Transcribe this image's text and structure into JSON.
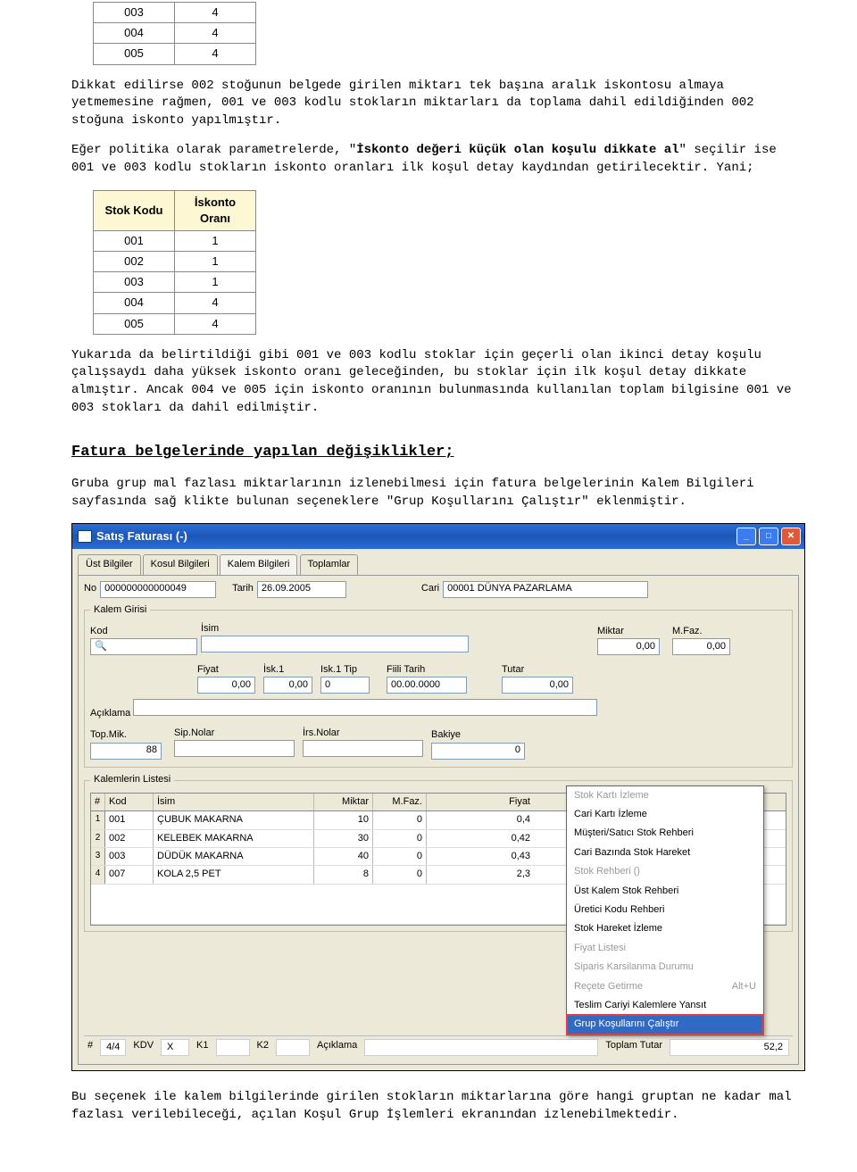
{
  "table1": {
    "rows": [
      [
        "003",
        "4"
      ],
      [
        "004",
        "4"
      ],
      [
        "005",
        "4"
      ]
    ]
  },
  "para1": "Dikkat edilirse 002 stoğunun belgede girilen miktarı tek başına aralık iskontosu almaya yetmemesine rağmen, 001 ve 003 kodlu stokların miktarları da toplama dahil edildiğinden 002 stoğuna iskonto yapılmıştır.",
  "para2a": "Eğer politika olarak parametrelerde, \"",
  "para2b": "İskonto değeri küçük olan koşulu dikkate al",
  "para2c": "\" seçilir ise 001 ve 003 kodlu stokların iskonto oranları ilk koşul detay kaydından getirilecektir. Yani;",
  "table2": {
    "headers": [
      "Stok Kodu",
      "İskonto Oranı"
    ],
    "rows": [
      [
        "001",
        "1"
      ],
      [
        "002",
        "1"
      ],
      [
        "003",
        "1"
      ],
      [
        "004",
        "4"
      ],
      [
        "005",
        "4"
      ]
    ]
  },
  "para3": "Yukarıda da belirtildiği gibi 001 ve 003 kodlu stoklar için geçerli olan ikinci detay koşulu çalışsaydı daha yüksek iskonto oranı geleceğinden, bu stoklar için ilk koşul detay dikkate almıştır. Ancak 004 ve 005 için iskonto oranının bulunmasında kullanılan toplam bilgisine 001 ve 003 stokları da dahil edilmiştir.",
  "h3": "Fatura belgelerinde yapılan değişiklikler;",
  "para4": "Gruba grup mal fazlası miktarlarının izlenebilmesi için fatura belgelerinin Kalem Bilgileri sayfasında sağ klikte bulunan seçeneklere \"Grup Koşullarını Çalıştır\" eklenmiştir.",
  "win": {
    "title": "Satış Faturası (-)",
    "tabs": [
      "Üst Bilgiler",
      "Kosul Bilgileri",
      "Kalem Bilgileri",
      "Toplamlar"
    ],
    "activeTab": 2,
    "top": {
      "no_l": "No",
      "no": "000000000000049",
      "tarih_l": "Tarih",
      "tarih": "26.09.2005",
      "cari_l": "Cari",
      "cari": "00001 DÜNYA PAZARLAMA"
    },
    "kg_legend": "Kalem Girisi",
    "kg": {
      "kod_l": "Kod",
      "isim_l": "İsim",
      "miktar_l": "Miktar",
      "miktar": "0,00",
      "mfaz_l": "M.Faz.",
      "mfaz": "0,00",
      "fiyat_l": "Fiyat",
      "fiyat": "0,00",
      "isk1_l": "İsk.1",
      "isk1": "0,00",
      "isk1tip_l": "Isk.1 Tip",
      "isk1tip": "0",
      "fiili_l": "Fiili Tarih",
      "fiili": "00.00.0000",
      "tutar_l": "Tutar",
      "tutar": "0,00",
      "aciklama_l": "Açıklama",
      "topmik_l": "Top.Mik.",
      "topmik": "88",
      "sipnolar_l": "Sip.Nolar",
      "irsnolar_l": "İrs.Nolar",
      "bakiye_l": "Bakiye",
      "bakiye": "0"
    },
    "list_legend": "Kalemlerin Listesi",
    "cols": [
      "#",
      "Kod",
      "İsim",
      "Miktar",
      "M.Faz.",
      "Fiyat"
    ],
    "rows": [
      [
        "1",
        "001",
        "ÇUBUK MAKARNA",
        "10",
        "0",
        "0,4"
      ],
      [
        "2",
        "002",
        "KELEBEK MAKARNA",
        "30",
        "0",
        "0,42"
      ],
      [
        "3",
        "003",
        "DÜDÜK MAKARNA",
        "40",
        "0",
        "0,43"
      ],
      [
        "4",
        "007",
        "KOLA 2,5 PET",
        "8",
        "0",
        "2,3"
      ]
    ],
    "menu": [
      {
        "t": "Stok Kartı İzleme",
        "d": true
      },
      {
        "t": "Cari Kartı İzleme"
      },
      {
        "t": "Müşteri/Satıcı Stok Rehberi"
      },
      {
        "t": "Cari Bazında Stok Hareket"
      },
      {
        "t": "Stok Rehberi ()",
        "d": true
      },
      {
        "t": "Üst Kalem Stok Rehberi"
      },
      {
        "t": "Üretici Kodu Rehberi"
      },
      {
        "t": "Stok Hareket İzleme"
      },
      {
        "t": "Fiyat Listesi",
        "d": true
      },
      {
        "t": "Siparis Karsilanma Durumu",
        "d": true
      },
      {
        "t": "Reçete Getirme",
        "d": true,
        "s": "Alt+U"
      },
      {
        "t": "Teslim Cariyi Kalemlere Yansıt"
      },
      {
        "t": "Grup Koşullarını Çalıştır",
        "sel": true
      }
    ],
    "status": {
      "pos_l": "#",
      "pos": "4/4",
      "kdv_l": "KDV",
      "x_l": "X",
      "k1_l": "K1",
      "k2_l": "K2",
      "ack_l": "Açıklama",
      "tt_l": "Toplam Tutar",
      "tt": "52,2"
    }
  },
  "para5": "Bu seçenek ile kalem bilgilerinde girilen stokların miktarlarına göre hangi gruptan ne kadar mal fazlası verilebileceği, açılan Koşul Grup İşlemleri ekranından izlenebilmektedir."
}
